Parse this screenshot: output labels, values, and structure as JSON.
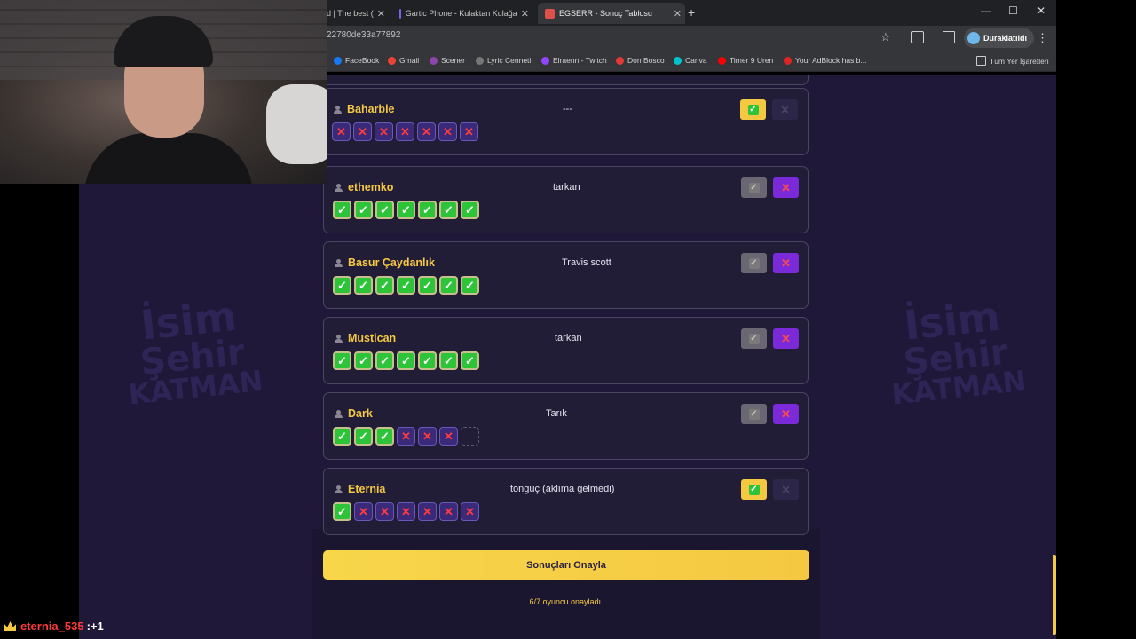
{
  "browser": {
    "tabs": [
      {
        "title": "d | The best (",
        "active": false
      },
      {
        "title": "Gartic Phone - Kulaktan Kulağa",
        "active": false
      },
      {
        "title": "EGSERR - Sonuç Tablosu",
        "active": true
      }
    ],
    "url": "22780de33a77892",
    "profile": "Duraklatıldı",
    "bookmarks": [
      "FaceBook",
      "Gmail",
      "Scener",
      "Lyric Cenneti",
      "Elraenn - Twitch",
      "Don Bosco",
      "Canva",
      "Timer 9 Uren",
      "Your AdBlock has b...",
      "Tüm Yer İşaretleri"
    ]
  },
  "watermark": {
    "l1": "İsim",
    "l2": "Şehir",
    "l3": "KATMAN"
  },
  "players": [
    {
      "name": "Baharbie",
      "answer": "---",
      "votes": [
        "no",
        "no",
        "no",
        "no",
        "no",
        "no",
        "no"
      ],
      "accept": "on",
      "reject": "off"
    },
    {
      "name": "ethemko",
      "answer": "tarkan",
      "votes": [
        "ok",
        "ok",
        "ok",
        "ok",
        "ok",
        "ok",
        "ok"
      ],
      "accept": "off",
      "reject": "on"
    },
    {
      "name": "Basur Çaydanlık",
      "answer": "Travis scott",
      "votes": [
        "ok",
        "ok",
        "ok",
        "ok",
        "ok",
        "ok",
        "ok"
      ],
      "accept": "off",
      "reject": "on"
    },
    {
      "name": "Mustican",
      "answer": "tarkan",
      "votes": [
        "ok",
        "ok",
        "ok",
        "ok",
        "ok",
        "ok",
        "ok"
      ],
      "accept": "off",
      "reject": "on"
    },
    {
      "name": "Dark",
      "answer": "Tarık",
      "votes": [
        "ok",
        "ok",
        "ok",
        "no",
        "no",
        "no",
        "empty"
      ],
      "accept": "off",
      "reject": "on"
    },
    {
      "name": "Eternia",
      "answer": "tonguç (aklıma gelmedi)",
      "votes": [
        "ok",
        "no",
        "no",
        "no",
        "no",
        "no",
        "no"
      ],
      "accept": "on",
      "reject": "off"
    }
  ],
  "confirm": {
    "label": "Sonuçları Onayla",
    "note": "6/7 oyuncu onayladı."
  },
  "chat": {
    "user": "eternia_535",
    "message": ":+1"
  },
  "colors": {
    "accent": "#f5c842",
    "card": "#221d37",
    "ok": "#2dc43a",
    "reject": "#7a2ad8"
  }
}
